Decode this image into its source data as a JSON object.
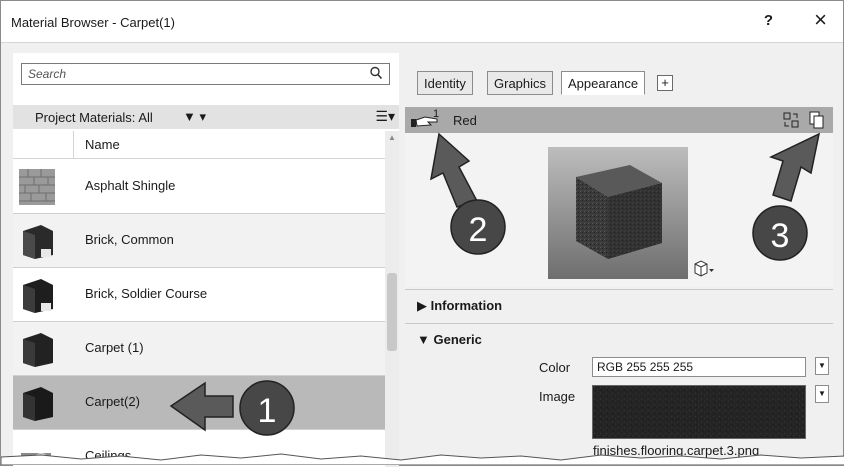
{
  "window": {
    "title": "Material Browser - Carpet(1)",
    "help_label": "?",
    "close_label": "×"
  },
  "search": {
    "placeholder": "Search"
  },
  "filter": {
    "label": "Project Materials: All"
  },
  "list": {
    "column_header": "Name",
    "items": [
      {
        "label": "Asphalt Shingle"
      },
      {
        "label": "Brick, Common"
      },
      {
        "label": "Brick, Soldier Course"
      },
      {
        "label": "Carpet (1)"
      },
      {
        "label": "Carpet(2)"
      },
      {
        "label": "Ceilings"
      }
    ]
  },
  "tabs": [
    {
      "label": "Identity"
    },
    {
      "label": "Graphics"
    },
    {
      "label": "Appearance"
    }
  ],
  "tab_add_label": "+",
  "asset": {
    "count": "1",
    "name": "Red"
  },
  "sections": {
    "information": "▶ Information",
    "generic": "▼ Generic"
  },
  "properties": {
    "color_label": "Color",
    "color_value": "RGB 255 255 255",
    "image_label": "Image",
    "image_file": "finishes.flooring.carpet.3.png"
  },
  "callouts": [
    "1",
    "2",
    "3"
  ]
}
